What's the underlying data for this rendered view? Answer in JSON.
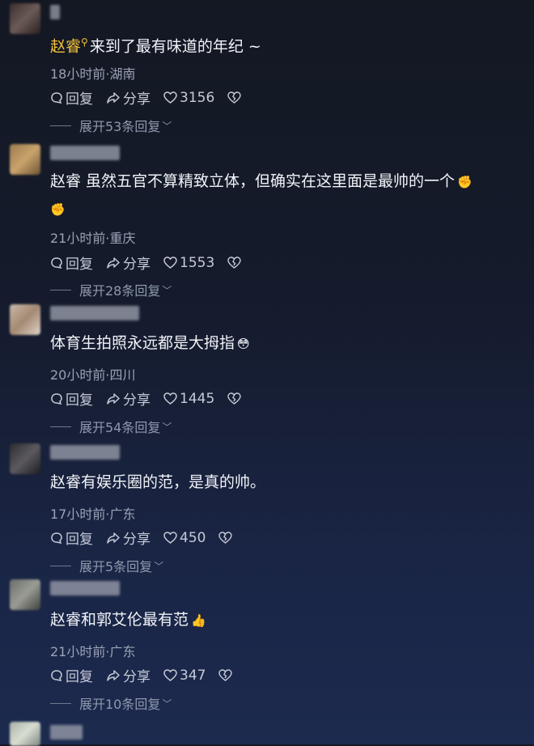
{
  "comments": [
    {
      "author": "赵睿",
      "text": "来到了最有味道的年纪 ~",
      "meta": "18小时前·湖南",
      "reply_label": "回复",
      "share_label": "分享",
      "likes": "3156",
      "expand_label": "展开53条回复"
    },
    {
      "text": "赵睿 虽然五官不算精致立体，但确实在这里面是最帅的一个",
      "meta": "21小时前·重庆",
      "reply_label": "回复",
      "share_label": "分享",
      "likes": "1553",
      "expand_label": "展开28条回复"
    },
    {
      "text": "体育生拍照永远都是大拇指",
      "meta": "20小时前·四川",
      "reply_label": "回复",
      "share_label": "分享",
      "likes": "1445",
      "expand_label": "展开54条回复"
    },
    {
      "text": "赵睿有娱乐圈的范，是真的帅。",
      "meta": "17小时前·广东",
      "reply_label": "回复",
      "share_label": "分享",
      "likes": "450",
      "expand_label": "展开5条回复"
    },
    {
      "text": "赵睿和郭艾伦最有范",
      "meta": "21小时前·广东",
      "reply_label": "回复",
      "share_label": "分享",
      "likes": "347",
      "expand_label": "展开10条回复"
    }
  ],
  "colors": {
    "author_highlight": "#f3c13a",
    "text": "#f1f3f8",
    "meta": "#9aa2b5"
  }
}
